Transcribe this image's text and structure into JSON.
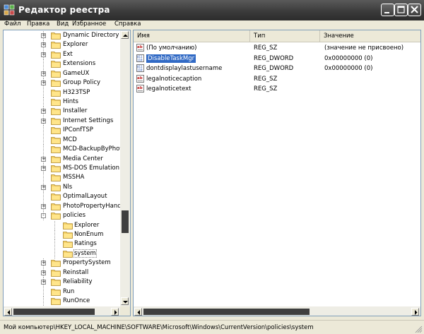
{
  "window": {
    "title": "Редактор реестра",
    "colors": {
      "titlebar": "#3b3b3b",
      "selection": "#316ac5",
      "pane_border": "#7f9db9"
    }
  },
  "menu": {
    "items": [
      "Файл",
      "Правка",
      "Вид",
      "Избранное",
      "Справка"
    ]
  },
  "tree": {
    "items": [
      {
        "label": "Dynamic Directory",
        "expander": "+",
        "level": 0
      },
      {
        "label": "Explorer",
        "expander": "+",
        "level": 0
      },
      {
        "label": "Ext",
        "expander": "+",
        "level": 0
      },
      {
        "label": "Extensions",
        "expander": "",
        "level": 0
      },
      {
        "label": "GameUX",
        "expander": "+",
        "level": 0
      },
      {
        "label": "Group Policy",
        "expander": "+",
        "level": 0
      },
      {
        "label": "H323TSP",
        "expander": "",
        "level": 0
      },
      {
        "label": "Hints",
        "expander": "",
        "level": 0
      },
      {
        "label": "Installer",
        "expander": "+",
        "level": 0
      },
      {
        "label": "Internet Settings",
        "expander": "+",
        "level": 0
      },
      {
        "label": "IPConfTSP",
        "expander": "",
        "level": 0
      },
      {
        "label": "MCD",
        "expander": "",
        "level": 0
      },
      {
        "label": "MCD-BackupByPhoto",
        "expander": "",
        "level": 0
      },
      {
        "label": "Media Center",
        "expander": "+",
        "level": 0
      },
      {
        "label": "MS-DOS Emulation",
        "expander": "+",
        "level": 0
      },
      {
        "label": "MSSHA",
        "expander": "",
        "level": 0
      },
      {
        "label": "Nls",
        "expander": "+",
        "level": 0
      },
      {
        "label": "OptimalLayout",
        "expander": "",
        "level": 0
      },
      {
        "label": "PhotoPropertyHandle",
        "expander": "+",
        "level": 0
      },
      {
        "label": "policies",
        "expander": "-",
        "level": 0,
        "open": true
      },
      {
        "label": "Explorer",
        "expander": "",
        "level": 1
      },
      {
        "label": "NonEnum",
        "expander": "",
        "level": 1
      },
      {
        "label": "Ratings",
        "expander": "",
        "level": 1
      },
      {
        "label": "system",
        "expander": "",
        "level": 1,
        "selected": true
      },
      {
        "label": "PropertySystem",
        "expander": "+",
        "level": 0
      },
      {
        "label": "Reinstall",
        "expander": "+",
        "level": 0
      },
      {
        "label": "Reliability",
        "expander": "+",
        "level": 0
      },
      {
        "label": "Run",
        "expander": "",
        "level": 0
      },
      {
        "label": "RunOnce",
        "expander": "",
        "level": 0
      }
    ]
  },
  "list": {
    "columns": [
      "Имя",
      "Тип",
      "Значение"
    ],
    "rows": [
      {
        "icon": "string-value-icon",
        "name": "(По умолчанию)",
        "type": "REG_SZ",
        "value": "(значение не присвоено)"
      },
      {
        "icon": "dword-value-icon",
        "name": "DisableTaskMgr",
        "type": "REG_DWORD",
        "value": "0x00000000 (0)",
        "selected": true
      },
      {
        "icon": "dword-value-icon",
        "name": "dontdisplaylastusername",
        "type": "REG_DWORD",
        "value": "0x00000000 (0)"
      },
      {
        "icon": "string-value-icon",
        "name": "legalnoticecaption",
        "type": "REG_SZ",
        "value": ""
      },
      {
        "icon": "string-value-icon",
        "name": "legalnoticetext",
        "type": "REG_SZ",
        "value": ""
      }
    ]
  },
  "status": {
    "path": "Мой компьютер\\HKEY_LOCAL_MACHINE\\SOFTWARE\\Microsoft\\Windows\\CurrentVersion\\policies\\system"
  }
}
